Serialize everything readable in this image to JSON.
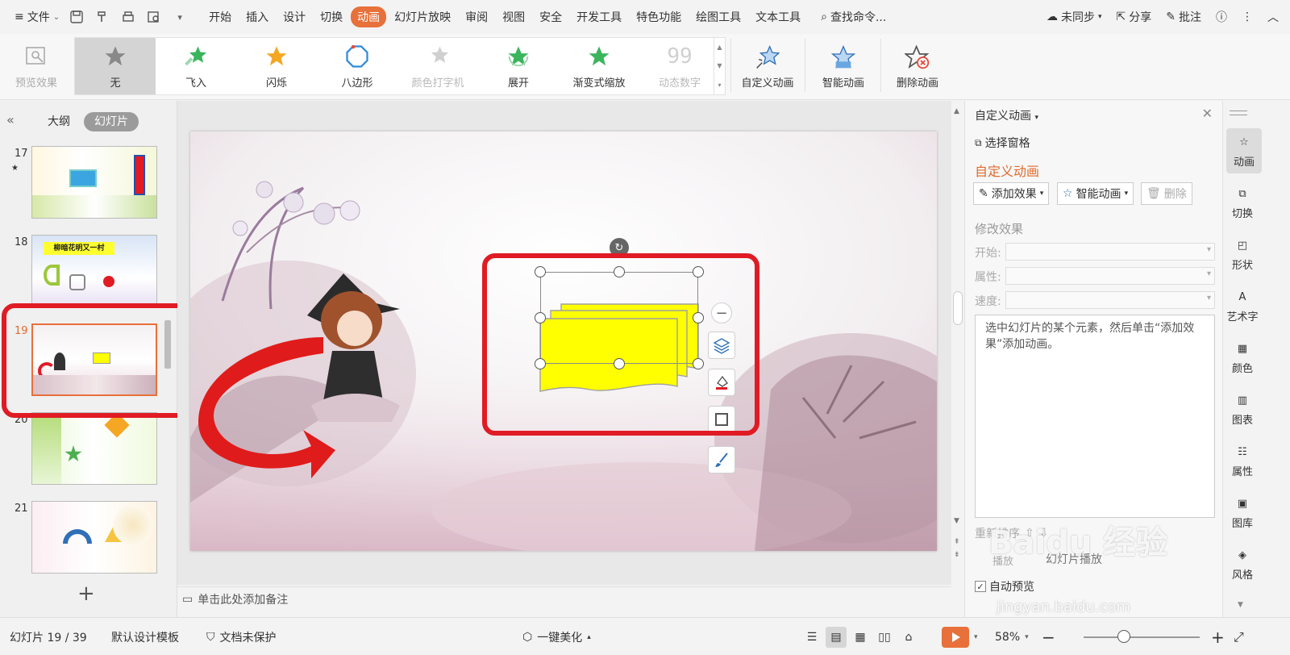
{
  "menubar": {
    "file_label": "文件",
    "tabs": [
      "开始",
      "插入",
      "设计",
      "切换",
      "动画",
      "幻灯片放映",
      "审阅",
      "视图",
      "安全",
      "开发工具",
      "特色功能",
      "绘图工具",
      "文本工具"
    ],
    "search_label": "查找命令...",
    "unsync_label": "未同步",
    "share_label": "分享",
    "comment_label": "批注",
    "accent_color": "#e8703a"
  },
  "ribbon": {
    "preview_label": "预览效果",
    "gallery": [
      "无",
      "飞入",
      "闪烁",
      "八边形",
      "颜色打字机",
      "展开",
      "渐变式缩放",
      "动态数字"
    ],
    "custom_label": "自定义动画",
    "smart_label": "智能动画",
    "delete_label": "删除动画"
  },
  "left_panel": {
    "tab_outline": "大纲",
    "tab_slides": "幻灯片",
    "slides": [
      {
        "number": "17",
        "star": "★"
      },
      {
        "number": "18",
        "caption": "柳暗花明又一村"
      },
      {
        "number": "19"
      },
      {
        "number": "20"
      },
      {
        "number": "21"
      }
    ]
  },
  "notes": {
    "placeholder": "单击此处添加备注"
  },
  "taskpane": {
    "title": "自定义动画",
    "select_pane": "选择窗格",
    "section_title": "自定义动画",
    "add_effect": "添加效果",
    "smart_anim": "智能动画",
    "delete": "删除",
    "modify_title": "修改效果",
    "start_label": "开始:",
    "property_label": "属性:",
    "speed_label": "速度:",
    "hint": "选中幻灯片的某个元素，然后单击“添加效果”添加动画。",
    "reorder": "重新排序",
    "play": "播放",
    "slideshow": "幻灯片播放",
    "auto_preview": "自动预览"
  },
  "sidebar": [
    "动画",
    "切换",
    "形状",
    "艺术字",
    "颜色",
    "图表",
    "属性",
    "图库",
    "风格"
  ],
  "status": {
    "slide_info": "幻灯片 19 / 39",
    "template": "默认设计模板",
    "protect": "文档未保护",
    "beautify": "一键美化",
    "zoom": "58%"
  },
  "watermark": {
    "text": "Baidu 经验",
    "sub": "jingyan.baidu.com"
  }
}
